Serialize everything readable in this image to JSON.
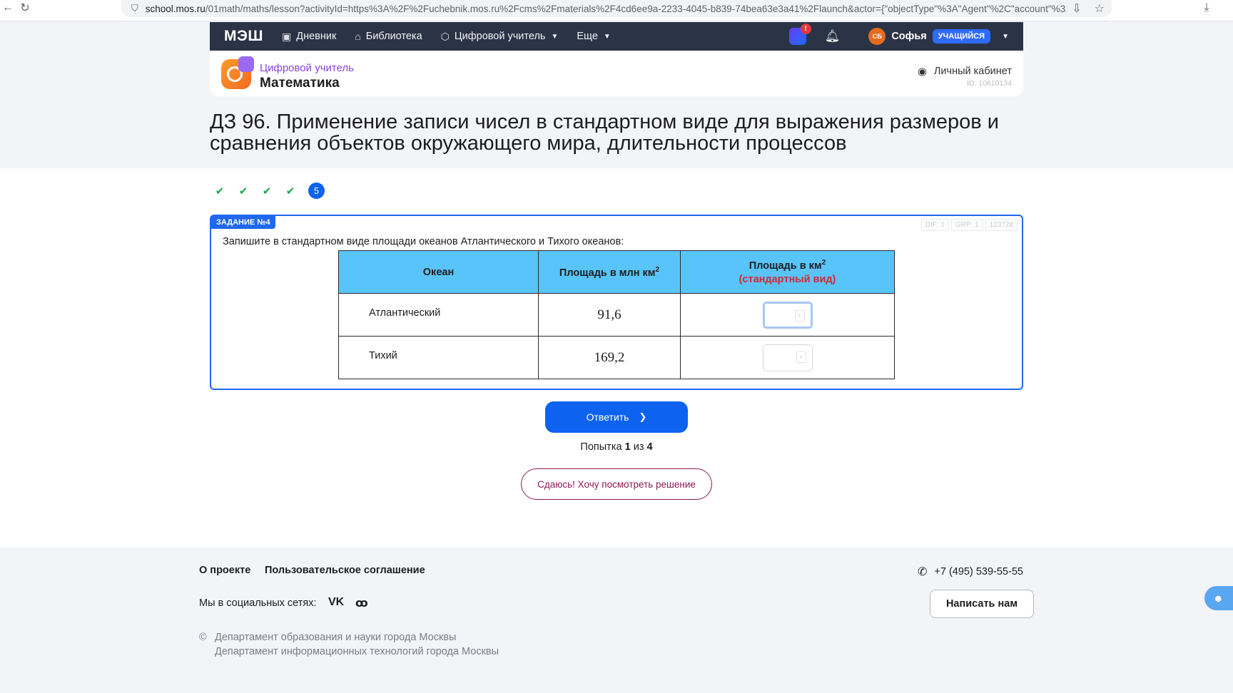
{
  "browser": {
    "url_host": "school.mos.ru",
    "url_path": "/01math/maths/lesson?activityId=https%3A%2F%2Fuchebnik.mos.ru%2Fcms%2Fmaterials%2F4cd6ee9a-2233-4045-b839-74bea63e3a41%2Flaunch&actor={\"objectType\"%3A\"Agent\"%2C\"account\"%3A"
  },
  "nav": {
    "logo": "МЭШ",
    "items": [
      {
        "label": "Дневник",
        "icon": "diary-icon"
      },
      {
        "label": "Библиотека",
        "icon": "bookmark-icon"
      },
      {
        "label": "Цифровой учитель",
        "icon": "cube-icon"
      },
      {
        "label": "Еще",
        "icon": ""
      }
    ],
    "notification_count": "!",
    "user_initials": "СБ",
    "user_name": "Софья",
    "user_role": "УЧАЩИЙСЯ"
  },
  "app": {
    "subtitle": "Цифровой учитель",
    "title": "Математика",
    "cabinet_label": "Личный кабинет",
    "user_id": "ID: 10610134"
  },
  "lesson": {
    "title": "ДЗ 96. Применение записи чисел в стандартном виде для выражения размеров и сравнения объектов окружающего мира, длительности процессов",
    "current_step": "5",
    "completed_steps": 4
  },
  "task": {
    "label": "ЗАДАНИЕ №4",
    "meta": [
      "DIF: 1",
      "GRP: 1",
      "123728"
    ],
    "question": "Запишите в стандартном виде площади океанов Атлантического и Тихого океанов:",
    "headers": {
      "ocean": "Океан",
      "area": "Площадь  в млн км",
      "area_sup": "2",
      "std": "Площадь в км",
      "std_sup": "2",
      "std_note": "(стандартный вид)"
    },
    "rows": [
      {
        "ocean": "Атлантический",
        "value": "91,6",
        "answer": ""
      },
      {
        "ocean": "Тихий",
        "value": "169,2",
        "answer": ""
      }
    ]
  },
  "actions": {
    "answer": "Ответить",
    "attempts_prefix": "Попытка",
    "attempt_current": "1",
    "attempts_mid": "из",
    "attempt_total": "4",
    "give_up": "Сдаюсь! Хочу посмотреть решение"
  },
  "footer": {
    "about": "О проекте",
    "agreement": "Пользовательское соглашение",
    "social_label": "Мы в социальных сетях:",
    "vk": "VK",
    "ok": "ꝏ",
    "copyright_line1": "Департамент образования и науки города Москвы",
    "copyright_line2": "Департамент информационных технологий города Москвы",
    "phone": "+7 (495) 539-55-55",
    "write_us": "Написать нам"
  }
}
